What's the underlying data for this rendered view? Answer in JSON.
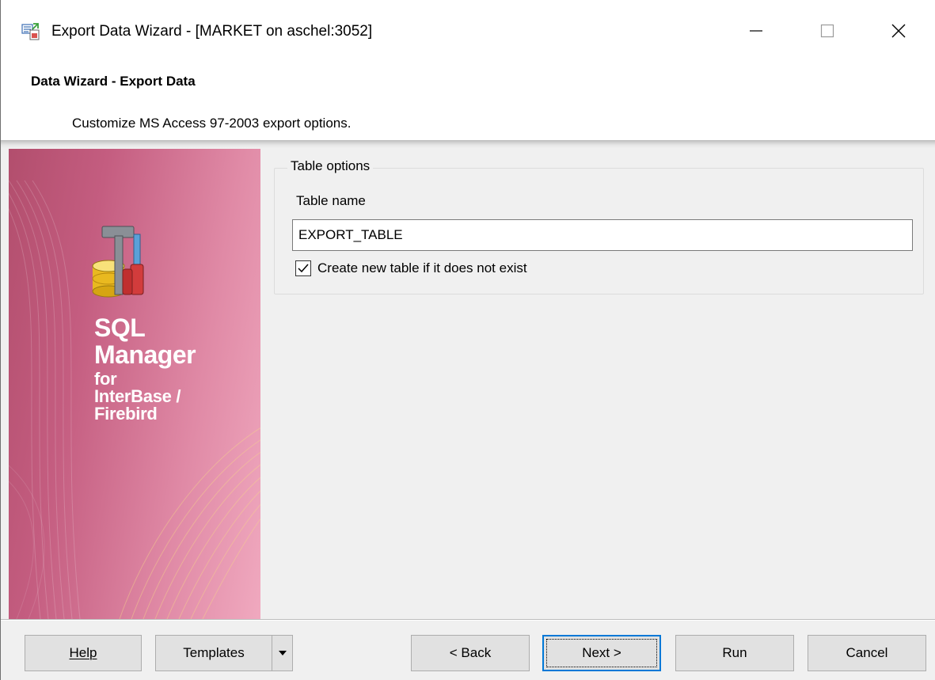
{
  "window": {
    "title": "Export Data Wizard - [MARKET on aschel:3052]",
    "icon": "export-wizard-icon"
  },
  "header": {
    "title": "Data Wizard - Export Data",
    "subtitle": "Customize MS Access 97-2003 export options."
  },
  "banner": {
    "line1": "SQL",
    "line2": "Manager",
    "line3": "for",
    "line4": "InterBase /",
    "line5": "Firebird",
    "logo_icon": "database-tools-icon"
  },
  "table_options": {
    "legend": "Table options",
    "table_name_label": "Table name",
    "table_name_value": "EXPORT_TABLE",
    "create_table_label": "Create new table if it does not exist",
    "create_table_checked": true
  },
  "buttons": {
    "help": "Help",
    "templates": "Templates",
    "back": "< Back",
    "next": "Next >",
    "run": "Run",
    "cancel": "Cancel"
  },
  "colors": {
    "banner_dark": "#b24e6d",
    "banner_light": "#f0a9bf",
    "focus_border": "#0078d7"
  }
}
